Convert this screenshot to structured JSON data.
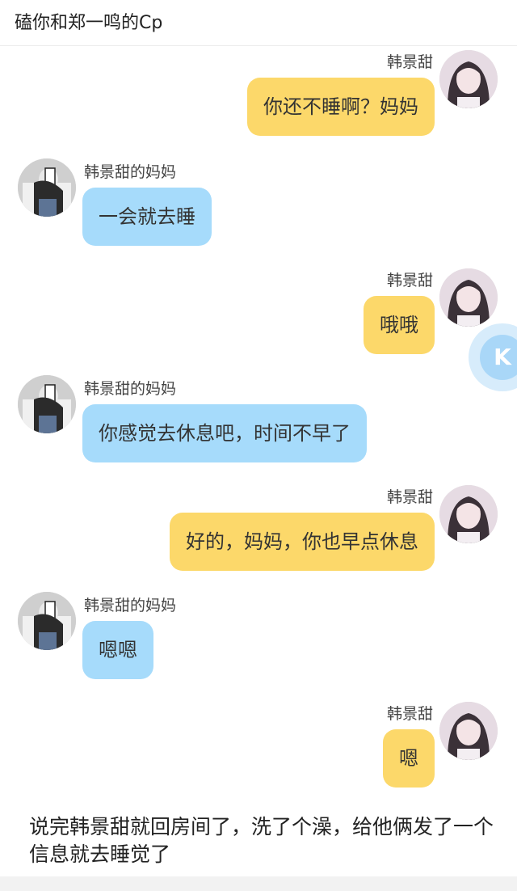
{
  "header": {
    "title": "磕你和郑一鸣的Cp"
  },
  "messages": [
    {
      "side": "right",
      "name": "韩景甜",
      "text": "你还不睡啊？妈妈"
    },
    {
      "side": "left",
      "name": "韩景甜的妈妈",
      "text": "一会就去睡"
    },
    {
      "side": "right",
      "name": "韩景甜",
      "text": "哦哦"
    },
    {
      "side": "left",
      "name": "韩景甜的妈妈",
      "text": "你感觉去休息吧，时间不早了"
    },
    {
      "side": "right",
      "name": "韩景甜",
      "text": "好的，妈妈，你也早点休息"
    },
    {
      "side": "left",
      "name": "韩景甜的妈妈",
      "text": "嗯嗯"
    },
    {
      "side": "right",
      "name": "韩景甜",
      "text": "嗯"
    }
  ],
  "narration": "说完韩景甜就回房间了，洗了个澡，给他俩发了一个信息就去睡觉了",
  "colors": {
    "right_bubble": "#fcd86a",
    "left_bubble": "#a6dbfb"
  },
  "icons": {
    "floating_button": "assistant-icon",
    "avatar_right": "girl-avatar",
    "avatar_left": "mother-avatar"
  }
}
